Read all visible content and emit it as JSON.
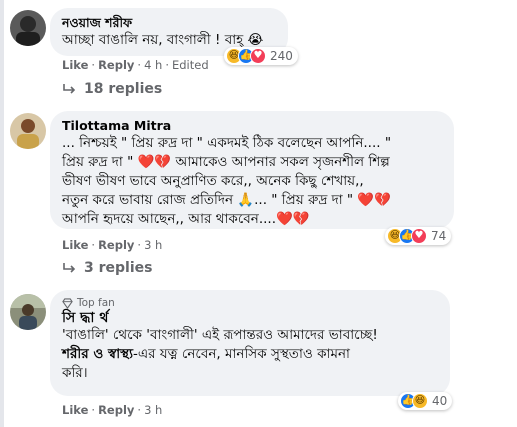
{
  "comments": [
    {
      "author": "নওয়াজ শরীফ",
      "lines": [
        "আচ্ছা বাঙালি নয়, বাংগালী ! বাহ্ 😭"
      ],
      "actions": {
        "like": "Like",
        "reply": "Reply",
        "time": "4 h",
        "edited": "Edited"
      },
      "reactions": {
        "types": [
          "haha-icon",
          "like-icon",
          "love-icon"
        ],
        "count": "240"
      },
      "replies": "18 replies"
    },
    {
      "author": "Tilottama Mitra",
      "lines": [
        "... নিশ্চয়ই \" প্রিয় রুদ্র দা \" একদমই ঠিক বলেছেন আপনি.... \"",
        "প্রিয় রুদ্র দা \" ❤️💔 আমাকেও আপনার সকল সৃজনশীল শিল্প",
        "ভীষণ ভীষণ ভাবে অনুপ্রাণিত করে,, অনেক কিছু শেখায়,,",
        "নতুন করে ভাবায় রোজ প্রতিদিন 🙏... \" প্রিয় রুদ্র দা \" ❤️💔",
        "আপনি হৃদয়ে আছেন,, আর থাকবেন....❤️💔"
      ],
      "actions": {
        "like": "Like",
        "reply": "Reply",
        "time": "3 h"
      },
      "reactions": {
        "types": [
          "haha-icon",
          "like-icon",
          "love-icon"
        ],
        "count": "74"
      },
      "replies": "3 replies"
    },
    {
      "badge": "Top fan",
      "author": "সি দ্ধা র্থ",
      "line1": "'বাঙালি' থেকে 'বাংগালী' এই রূপান্তরও আমাদের ভাবাচ্ছে!",
      "line2_bold": "শরীর ও স্বাস্থ্য",
      "line2_rest": "-এর যত্ন নেবেন, মানসিক সুস্থতাও কামনা",
      "line3": "করি।",
      "actions": {
        "like": "Like",
        "reply": "Reply",
        "time": "3 h"
      },
      "reactions": {
        "types": [
          "like-icon",
          "haha-icon"
        ],
        "count": "40"
      }
    }
  ],
  "colors": {
    "bubble": "#f0f2f5",
    "meta": "#65676b",
    "like": "#1877f2",
    "love": "#f33e58",
    "haha": "#f7b928"
  }
}
